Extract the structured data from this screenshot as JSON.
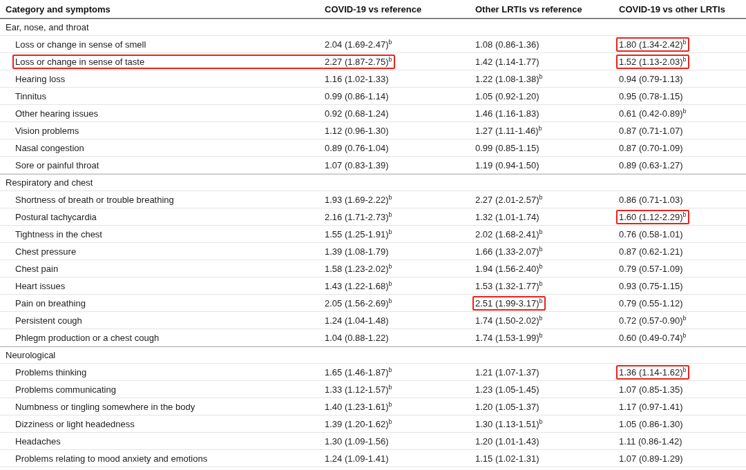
{
  "table": {
    "columns": [
      "Category and symptoms",
      "COVID-19 vs reference",
      "Other LRTIs vs reference",
      "COVID-19 vs other LRTIs"
    ],
    "sections": [
      {
        "title": "Ear, nose, and throat",
        "rows": [
          {
            "cells": [
              {
                "text": "Loss or change in sense of smell",
                "boxed": false
              },
              {
                "text": "2.04 (1.69-2.47)$^{b}$",
                "boxed": false
              },
              {
                "text": "1.08 (0.86-1.36)",
                "boxed": false
              },
              {
                "text": "1.80 (1.34-2.42)$^{b}$",
                "boxed": true
              }
            ]
          },
          {
            "cells": [
              {
                "text": "Loss or change in sense of taste",
                "boxed": true
              },
              {
                "text": "2.27 (1.87-2.75)$^{b}$",
                "boxed": true
              },
              {
                "text": "1.42 (1.14-1.77)",
                "boxed": false
              },
              {
                "text": "1.52 (1.13-2.03)$^{b}$",
                "boxed": true
              }
            ]
          },
          {
            "cells": [
              {
                "text": "Hearing loss",
                "boxed": false
              },
              {
                "text": "1.16 (1.02-1.33)",
                "boxed": false
              },
              {
                "text": "1.22 (1.08-1.38)$^{b}$",
                "boxed": false
              },
              {
                "text": "0.94 (0.79-1.13)",
                "boxed": false
              }
            ]
          },
          {
            "cells": [
              {
                "text": "Tinnitus",
                "boxed": false
              },
              {
                "text": "0.99 (0.86-1.14)",
                "boxed": false
              },
              {
                "text": "1.05 (0.92-1.20)",
                "boxed": false
              },
              {
                "text": "0.95 (0.78-1.15)",
                "boxed": false
              }
            ]
          },
          {
            "cells": [
              {
                "text": "Other hearing issues",
                "boxed": false
              },
              {
                "text": "0.92 (0.68-1.24)",
                "boxed": false
              },
              {
                "text": "1.46 (1.16-1.83)",
                "boxed": false
              },
              {
                "text": "0.61 (0.42-0.89)$^{b}$",
                "boxed": false
              }
            ]
          },
          {
            "cells": [
              {
                "text": "Vision problems",
                "boxed": false
              },
              {
                "text": "1.12 (0.96-1.30)",
                "boxed": false
              },
              {
                "text": "1.27 (1.11-1.46)$^{b}$",
                "boxed": false
              },
              {
                "text": "0.87 (0.71-1.07)",
                "boxed": false
              }
            ]
          },
          {
            "cells": [
              {
                "text": "Nasal congestion",
                "boxed": false
              },
              {
                "text": "0.89 (0.76-1.04)",
                "boxed": false
              },
              {
                "text": "0.99 (0.85-1.15)",
                "boxed": false
              },
              {
                "text": "0.87 (0.70-1.09)",
                "boxed": false
              }
            ]
          },
          {
            "cells": [
              {
                "text": "Sore or painful throat",
                "boxed": false
              },
              {
                "text": "1.07 (0.83-1.39)",
                "boxed": false
              },
              {
                "text": "1.19 (0.94-1.50)",
                "boxed": false
              },
              {
                "text": "0.89 (0.63-1.27)",
                "boxed": false
              }
            ]
          }
        ]
      },
      {
        "title": "Respiratory and chest",
        "rows": [
          {
            "cells": [
              {
                "text": "Shortness of breath or trouble breathing",
                "boxed": false
              },
              {
                "text": "1.93 (1.69-2.22)$^{b}$",
                "boxed": false
              },
              {
                "text": "2.27 (2.01-2.57)$^{b}$",
                "boxed": false
              },
              {
                "text": "0.86 (0.71-1.03)",
                "boxed": false
              }
            ]
          },
          {
            "cells": [
              {
                "text": "Postural tachycardia",
                "boxed": false
              },
              {
                "text": "2.16 (1.71-2.73)$^{b}$",
                "boxed": false
              },
              {
                "text": "1.32 (1.01-1.74)",
                "boxed": false
              },
              {
                "text": "1.60 (1.12-2.29)$^{b}$",
                "boxed": true
              }
            ]
          },
          {
            "cells": [
              {
                "text": "Tightness in the chest",
                "boxed": false
              },
              {
                "text": "1.55 (1.25-1.91)$^{b}$",
                "boxed": false
              },
              {
                "text": "2.02 (1.68-2.41)$^{b}$",
                "boxed": false
              },
              {
                "text": "0.76 (0.58-1.01)",
                "boxed": false
              }
            ]
          },
          {
            "cells": [
              {
                "text": "Chest pressure",
                "boxed": false
              },
              {
                "text": "1.39 (1.08-1.79)",
                "boxed": false
              },
              {
                "text": "1.66 (1.33-2.07)$^{b}$",
                "boxed": false
              },
              {
                "text": "0.87 (0.62-1.21)",
                "boxed": false
              }
            ]
          },
          {
            "cells": [
              {
                "text": "Chest pain",
                "boxed": false
              },
              {
                "text": "1.58 (1.23-2.02)$^{b}$",
                "boxed": false
              },
              {
                "text": "1.94 (1.56-2.40)$^{b}$",
                "boxed": false
              },
              {
                "text": "0.79 (0.57-1.09)",
                "boxed": false
              }
            ]
          },
          {
            "cells": [
              {
                "text": "Heart issues",
                "boxed": false
              },
              {
                "text": "1.43 (1.22-1.68)$^{b}$",
                "boxed": false
              },
              {
                "text": "1.53 (1.32-1.77)$^{b}$",
                "boxed": false
              },
              {
                "text": "0.93 (0.75-1.15)",
                "boxed": false
              }
            ]
          },
          {
            "cells": [
              {
                "text": "Pain on breathing",
                "boxed": false
              },
              {
                "text": "2.05 (1.56-2.69)$^{b}$",
                "boxed": false
              },
              {
                "text": "2.51 (1.99-3.17)$^{b}$",
                "boxed": true
              },
              {
                "text": "0.79 (0.55-1.12)",
                "boxed": false
              }
            ]
          },
          {
            "cells": [
              {
                "text": "Persistent cough",
                "boxed": false
              },
              {
                "text": "1.24 (1.04-1.48)",
                "boxed": false
              },
              {
                "text": "1.74 (1.50-2.02)$^{b}$",
                "boxed": false
              },
              {
                "text": "0.72 (0.57-0.90)$^{b}$",
                "boxed": false
              }
            ]
          },
          {
            "cells": [
              {
                "text": "Phlegm production or a chest cough",
                "boxed": false
              },
              {
                "text": "1.04 (0.88-1.22)",
                "boxed": false
              },
              {
                "text": "1.74 (1.53-1.99)$^{b}$",
                "boxed": false
              },
              {
                "text": "0.60 (0.49-0.74)$^{b}$",
                "boxed": false
              }
            ]
          }
        ]
      },
      {
        "title": "Neurological",
        "rows": [
          {
            "cells": [
              {
                "text": "Problems thinking",
                "boxed": false
              },
              {
                "text": "1.65 (1.46-1.87)$^{b}$",
                "boxed": false
              },
              {
                "text": "1.21 (1.07-1.37)",
                "boxed": false
              },
              {
                "text": "1.36 (1.14-1.62)$^{b}$",
                "boxed": true
              }
            ]
          },
          {
            "cells": [
              {
                "text": "Problems communicating",
                "boxed": false
              },
              {
                "text": "1.33 (1.12-1.57)$^{b}$",
                "boxed": false
              },
              {
                "text": "1.23 (1.05-1.45)",
                "boxed": false
              },
              {
                "text": "1.07 (0.85-1.35)",
                "boxed": false
              }
            ]
          },
          {
            "cells": [
              {
                "text": "Numbness or tingling somewhere in the body",
                "boxed": false
              },
              {
                "text": "1.40 (1.23-1.61)$^{b}$",
                "boxed": false
              },
              {
                "text": "1.20 (1.05-1.37)",
                "boxed": false
              },
              {
                "text": "1.17 (0.97-1.41)",
                "boxed": false
              }
            ]
          },
          {
            "cells": [
              {
                "text": "Dizziness or light headedness",
                "boxed": false
              },
              {
                "text": "1.39 (1.20-1.62)$^{b}$",
                "boxed": false
              },
              {
                "text": "1.30 (1.13-1.51)$^{b}$",
                "boxed": false
              },
              {
                "text": "1.05 (0.86-1.30)",
                "boxed": false
              }
            ]
          },
          {
            "cells": [
              {
                "text": "Headaches",
                "boxed": false
              },
              {
                "text": "1.30 (1.09-1.56)",
                "boxed": false
              },
              {
                "text": "1.20 (1.01-1.43)",
                "boxed": false
              },
              {
                "text": "1.11 (0.86-1.42)",
                "boxed": false
              }
            ]
          },
          {
            "cells": [
              {
                "text": "Problems relating to mood anxiety and emotions",
                "boxed": false
              },
              {
                "text": "1.24 (1.09-1.41)",
                "boxed": false
              },
              {
                "text": "1.15 (1.02-1.31)",
                "boxed": false
              },
              {
                "text": "1.07 (0.89-1.29)",
                "boxed": false
              }
            ]
          }
        ]
      }
    ]
  }
}
